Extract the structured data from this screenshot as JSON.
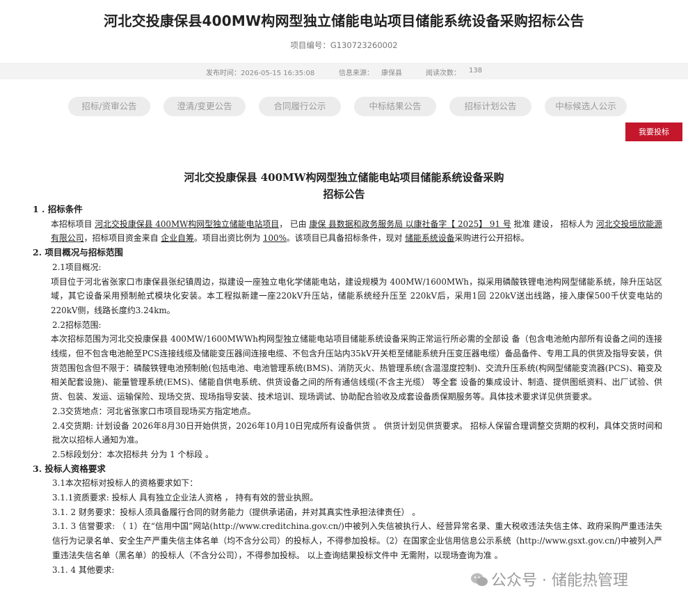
{
  "header": {
    "title": "河北交投康保县400MW构网型独立储能电站项目储能系统设备采购招标公告",
    "project_no": "项目编号：G130723260002"
  },
  "meta": {
    "publish_time": "发布时间：2026-05-15 16:35:08",
    "source": "信息来源：",
    "source_value": "康保县",
    "views": "阅读次数：",
    "views_value": "138"
  },
  "tabs": [
    "招标/资审公告",
    "澄清/变更公告",
    "合同履行公示",
    "中标结果公告",
    "招标计划公告",
    "中标候选人公示"
  ],
  "bid_button": "我要投标",
  "doc": {
    "title_line1": "河北交投康保县 400MW构网型独立储能电站项目储能系统设备采购",
    "title_line2": "招标公告",
    "s1_heading": "1 .  招标条件",
    "s1_a": "本招标项目",
    "s1_project": "河北交投康保县 400MW构网型独立储能电站项目",
    "s1_b": "，  已由",
    "s1_approver": "康保 县数据和政务服务局 以康社备字【 2025】 91 号",
    "s1_c": "批准 建设，  招标",
    "s1_d": "人为",
    "s1_owner": "河北交投垣欣能源有限公司",
    "s1_e": "，招标项目资金来自",
    "s1_fund": "企业自筹",
    "s1_f": "。项目出资比例为",
    "s1_ratio": "100%",
    "s1_g": "。该项目已具备招标条件，现对",
    "s1_scope": "储能系统设备",
    "s1_h": "采购进行公开招标。",
    "s2_heading": "2. 项目概况与招标范围",
    "s2_1": "2.1项目概况:",
    "s2_1_text": "项目位于河北省张家口市康保县张纪镇周边，拟建设一座独立电化学储能电站，建设规模为 400MW/1600MWh，拟采用磷酸铁锂电池构网型储能系统，除升压站区域，其它设备采用预制舱式模块化安装。本工程拟新建一座220kV升压站，储能系统经升压至 220kV后，采用1回 220kV送出线路，接入康保500千伏变电站的220kV侧，线路长度约3.24km。",
    "s2_2": "2.2招标范围:",
    "s2_2_text": "本次招标范围为河北交投康保县 400MW/1600MWWh构网型独立储能电站项目储能系统设备采购正常运行所必需的全部设 备（包含电池舱内部所有设备之间的连接线缆，但不包含电池舱至PCS连接线缆及储能变压器间连接电缆、不包含升压站内35kV开关柜至储能系统升压变压器电缆）备品备件、专用工具的供货及指导安装，供货范围包含但不限于：磷酸铁锂电池预制舱(包括电池、电池管理系统(BMS)、消防灭火、热管理系统(含温湿度控制)、交流升压系统(构网型储能变流器(PCS)、箱变及相关配套设施)、能量管理系统(EMS)、储能自供电系统、供货设备之间的所有通信线缆(不含主光缆） 等全套 设备的集成设计、制造、提供图纸资料、出厂试验、供货、包装、发运、运输保险、现场交货、现场指导安装、技术培训、现场调试、协助配合验收及成套设备质保期服务等。具体技术要求详见供货要求。",
    "s2_3": "2.3交货地点：河北省张家口市项目现场买方指定地点。",
    "s2_4": "2.4交货期:  计划设备 2026年8月30日开始供货，2026年10月10日完成所有设备供货 。 供货计划见供货要求。 招标人保留合理调整交货期的权利，具体交货时间和批次以招标人通知为准。",
    "s2_5": "2.5标段划分：本次招标共  分为 1 个标段  。",
    "s3_heading": "3. 投标人资格要求",
    "s3_1": "3.1本次招标对投标人的资格要求如下：",
    "s3_1_1": "3.1.1资质要求:  投标人 具有独立企业法人资格 ，  持有有效的营业执照。",
    "s3_1_2": "3.1. 2 财务要求：投标人须具备履行合同的财务能力（提供承诺函，并对其真实性承担法律责任）  。",
    "s3_1_3": "3.1. 3 信誉要求: （ 1）在“信用中国”网站(http://www.creditchina.gov.cn/)中被列入失信被执行人、经营异常名录、重大税收违法失信主体、政府采购严重违法失信行为记录名单、安全生产严重失信主体名单（均不含分公司）的投标人，不得参加投标。（2）在国家企业信用信息公示系统（http://www.gsxt.gov.cn/)中被列入严重违法失信名单（黑名单）的投标人（不含分公司），不得参加投标。 以上查询结果投标文件中 无需附，以现场查询为准 。",
    "s3_1_4": "3.1. 4 其他要求:"
  },
  "watermark": "公众号 · 储能热管理",
  "colors": {
    "accent": "#c4172c",
    "tab_bg": "#ececec",
    "meta_bg": "#f3f3f3"
  }
}
